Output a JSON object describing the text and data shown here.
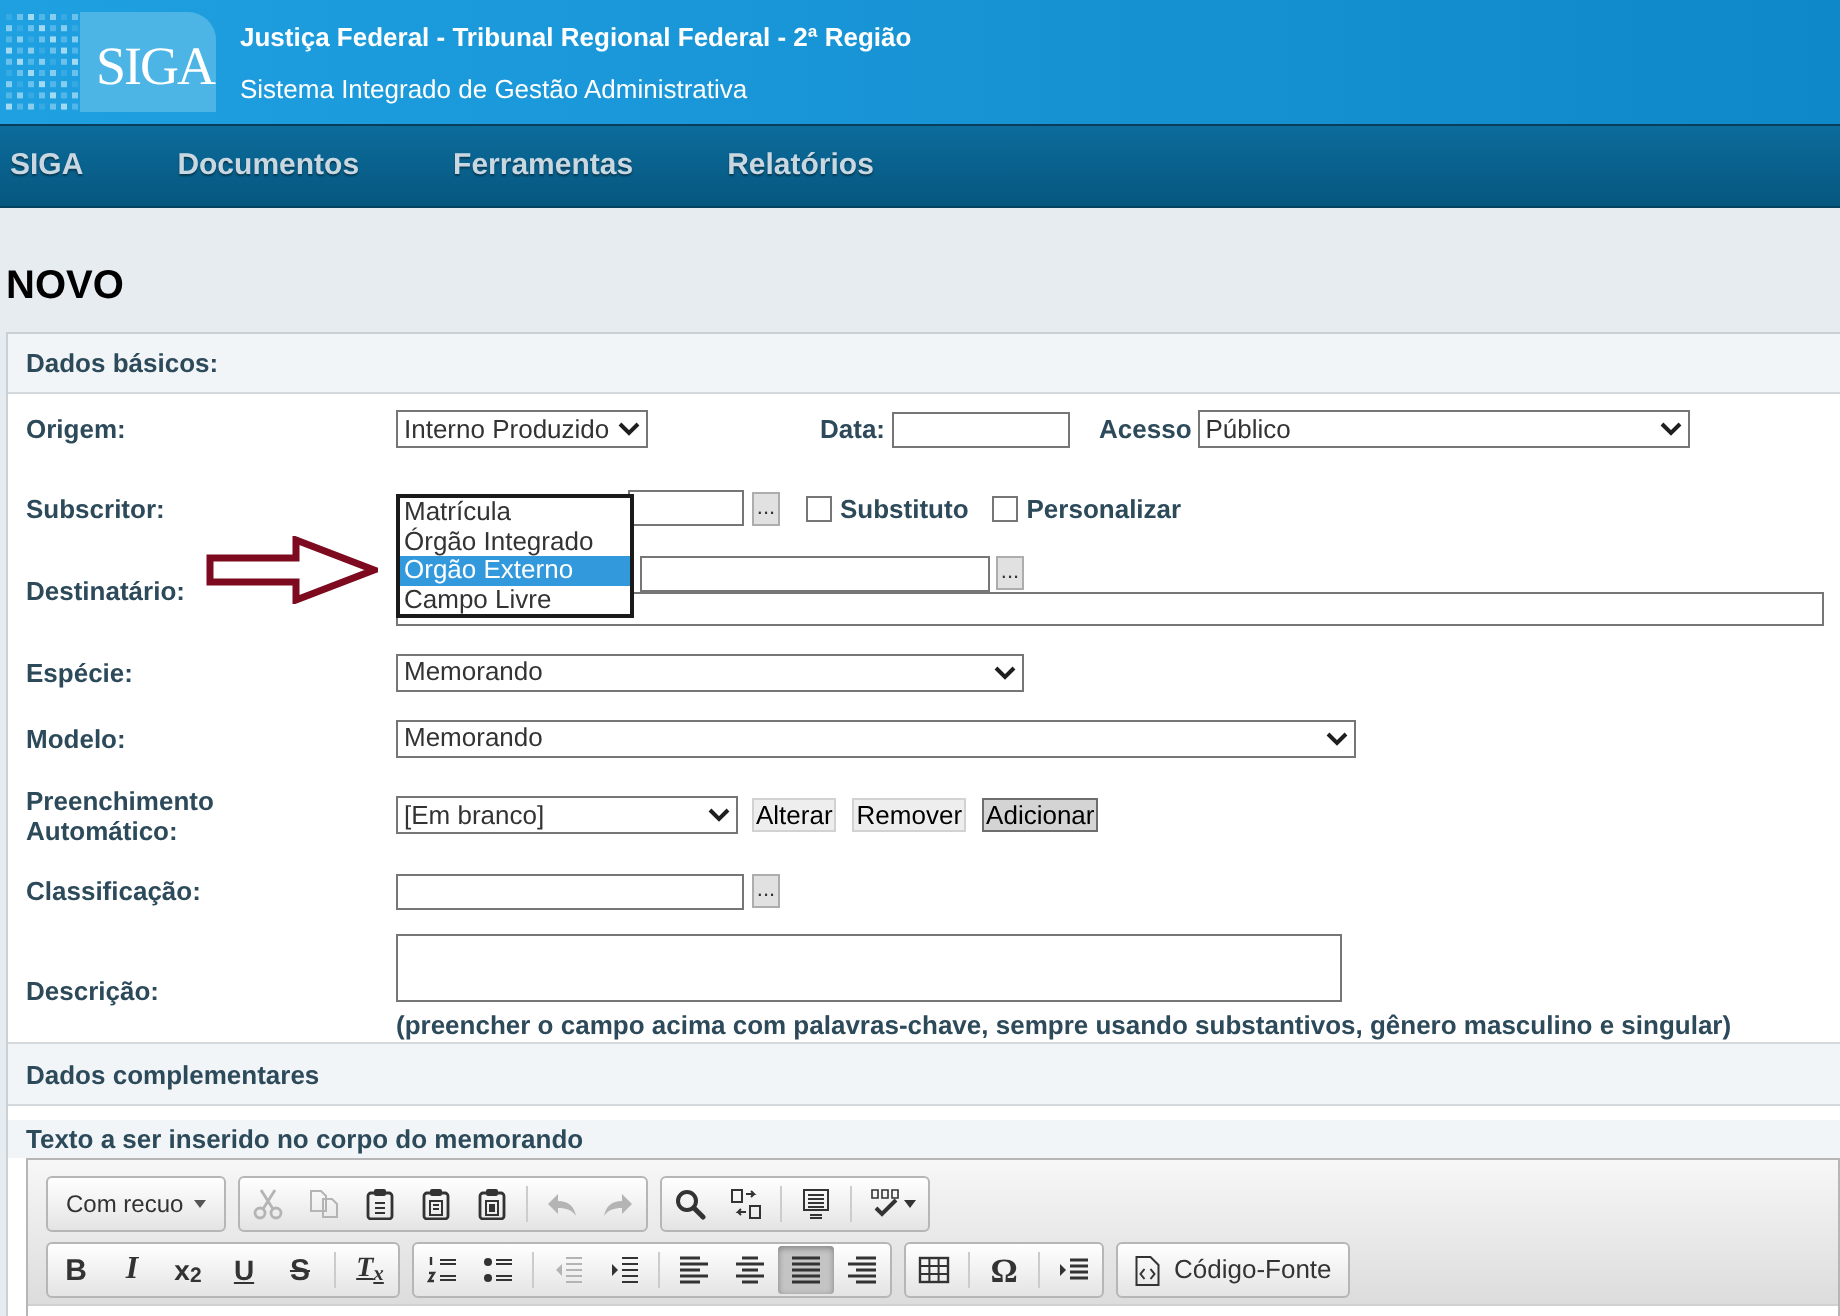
{
  "header": {
    "logo": "SIGA",
    "title": "Justiça Federal - Tribunal Regional Federal - 2ª Região",
    "subtitle": "Sistema Integrado de Gestão Administrativa"
  },
  "menu": [
    "SIGA",
    "Documentos",
    "Ferramentas",
    "Relatórios"
  ],
  "page_title": "NOVO",
  "basic": {
    "heading": "Dados básicos:",
    "origem": {
      "label": "Origem:",
      "value": "Interno Produzido"
    },
    "data": {
      "label": "Data:"
    },
    "acesso": {
      "label": "Acesso",
      "value": "Público"
    },
    "subscritor": {
      "label": "Subscritor:",
      "browse": "...",
      "checkboxes": [
        {
          "label": "Substituto",
          "checked": false
        },
        {
          "label": "Personalizar",
          "checked": false
        }
      ]
    },
    "destinatario": {
      "label": "Destinatário:",
      "browse": "...",
      "options": [
        {
          "label": "Matrícula",
          "selected": false
        },
        {
          "label": "Órgão Integrado",
          "selected": false
        },
        {
          "label": "Orgão Externo",
          "selected": true
        },
        {
          "label": "Campo Livre",
          "selected": false
        }
      ]
    },
    "especie": {
      "label": "Espécie:",
      "value": "Memorando"
    },
    "modelo": {
      "label": "Modelo:",
      "value": "Memorando"
    },
    "preenchimento": {
      "label": "Preenchimento Automático:",
      "value": "[Em branco]",
      "buttons": [
        {
          "label": "Alterar",
          "focused": false
        },
        {
          "label": "Remover",
          "focused": false
        },
        {
          "label": "Adicionar",
          "focused": true
        }
      ]
    },
    "classificacao": {
      "label": "Classificação:",
      "browse": "..."
    },
    "descricao": {
      "label": "Descrição:",
      "hint": "(preencher o campo acima com palavras-chave, sempre usando substantivos, gênero masculino e singular)"
    }
  },
  "complementary": {
    "heading": "Dados complementares",
    "editor_label": "Texto a ser inserido no corpo do memorando",
    "toolbar": [
      {
        "groups": [
          {
            "clusters": [
              [
                {
                  "kind": "combo",
                  "label": "Com recuo"
                }
              ]
            ]
          },
          {
            "clusters": [
              [
                {
                  "kind": "cut",
                  "disabled": true
                },
                {
                  "kind": "copy",
                  "disabled": true
                },
                {
                  "kind": "paste",
                  "disabled": false
                },
                {
                  "kind": "paste-text",
                  "disabled": false
                },
                {
                  "kind": "paste-word",
                  "disabled": false
                }
              ],
              [
                {
                  "kind": "undo",
                  "disabled": true
                },
                {
                  "kind": "redo",
                  "disabled": true
                }
              ]
            ]
          },
          {
            "clusters": [
              [
                {
                  "kind": "find"
                },
                {
                  "kind": "replace"
                }
              ],
              [
                {
                  "kind": "show-blocks"
                }
              ],
              [
                {
                  "kind": "spellcheck"
                }
              ]
            ]
          }
        ]
      },
      {
        "groups": [
          {
            "clusters": [
              [
                {
                  "kind": "bold",
                  "label": "B"
                },
                {
                  "kind": "italic",
                  "label": "I"
                },
                {
                  "kind": "subscript",
                  "label": "x$_{2}$"
                },
                {
                  "kind": "underline",
                  "label": "U"
                },
                {
                  "kind": "strike",
                  "label": "S"
                }
              ],
              [
                {
                  "kind": "remove-format",
                  "label": "T$_{x}$"
                }
              ]
            ]
          },
          {
            "clusters": [
              [
                {
                  "kind": "numbered-list"
                },
                {
                  "kind": "bulleted-list"
                }
              ],
              [
                {
                  "kind": "outdent",
                  "disabled": true
                },
                {
                  "kind": "indent",
                  "disabled": false
                }
              ],
              [
                {
                  "kind": "align-left",
                  "on": false
                },
                {
                  "kind": "align-center",
                  "on": false
                },
                {
                  "kind": "justify",
                  "on": true
                },
                {
                  "kind": "align-right",
                  "on": false
                }
              ]
            ]
          },
          {
            "clusters": [
              [
                {
                  "kind": "table"
                }
              ],
              [
                {
                  "kind": "special-char",
                  "label": "Ω"
                }
              ],
              [
                {
                  "kind": "blockquote"
                }
              ]
            ]
          },
          {
            "clusters": [
              [
                {
                  "kind": "source",
                  "label": "Código-Fonte"
                }
              ]
            ]
          }
        ]
      }
    ]
  }
}
